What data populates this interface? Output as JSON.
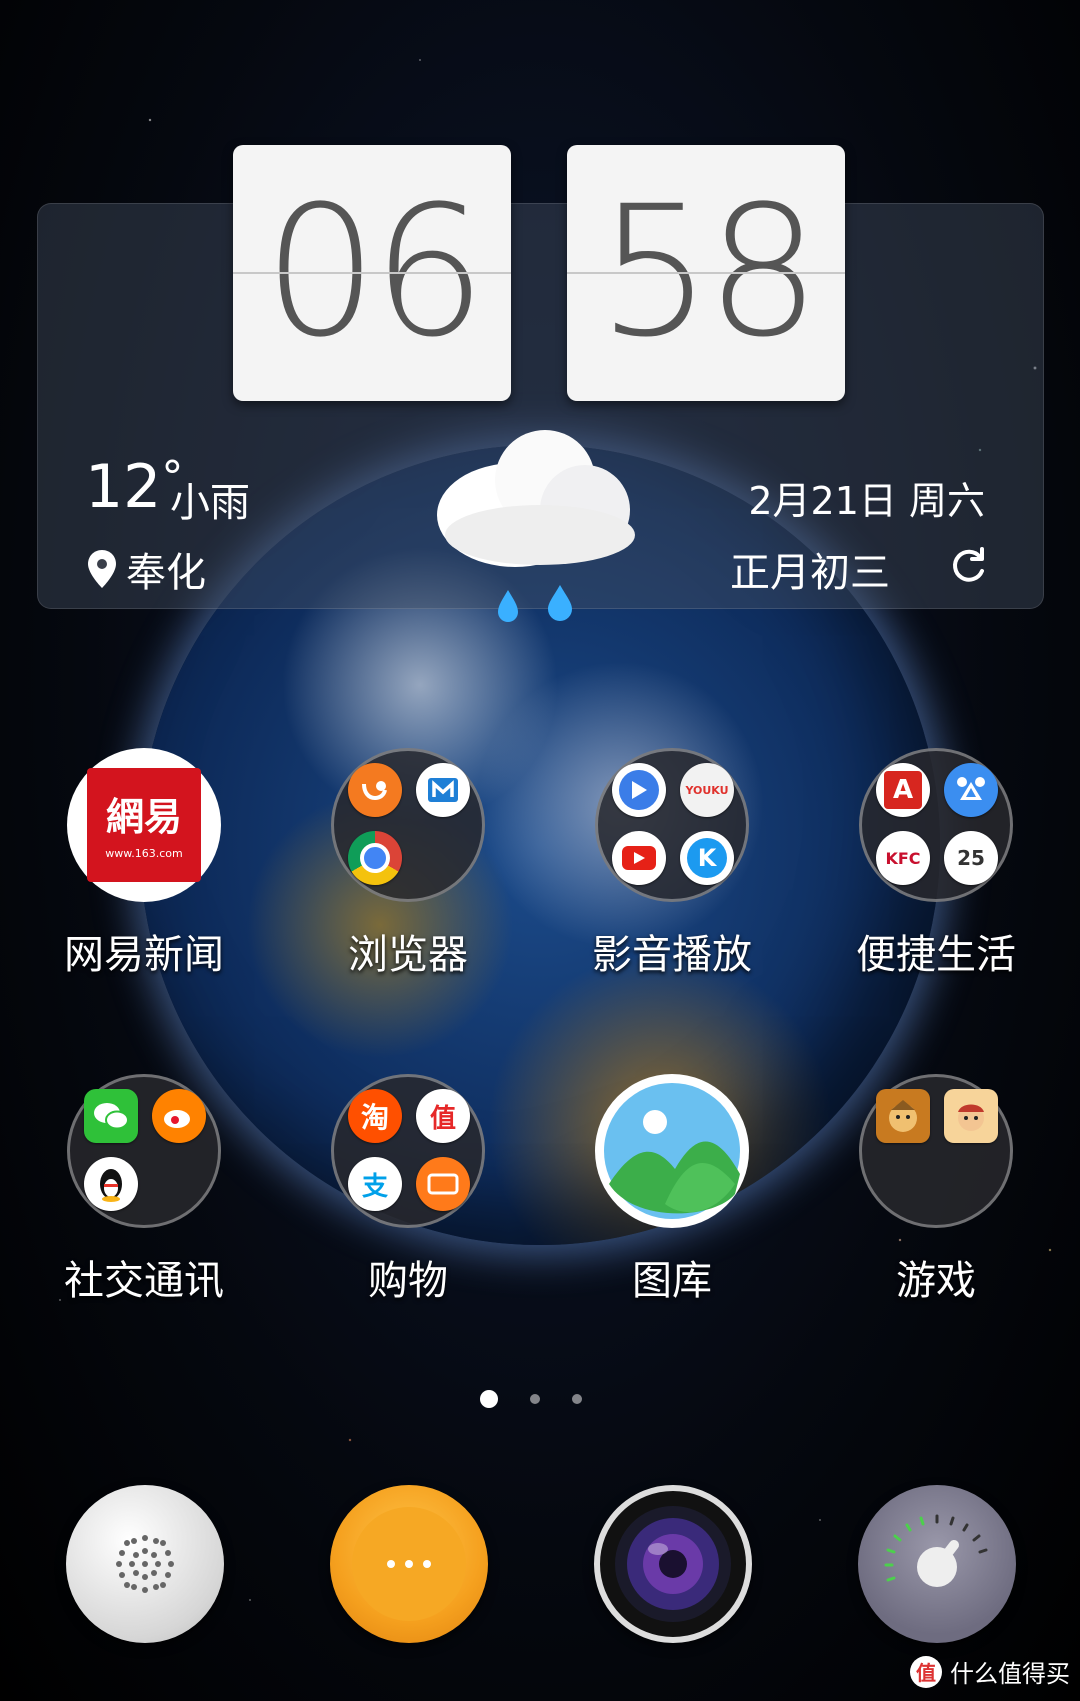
{
  "clock": {
    "hours": "06",
    "minutes": "58"
  },
  "weather": {
    "temp": "12",
    "degree_symbol": "°",
    "condition": "小雨",
    "city": "奉化"
  },
  "date": {
    "solar": "2月21日  周六",
    "lunar": "正月初三"
  },
  "apps_row1": [
    {
      "label": "网易新闻",
      "logo_text": "網易",
      "logo_sub": "www.163.com"
    },
    {
      "label": "浏览器"
    },
    {
      "label": "影音播放"
    },
    {
      "label": "便捷生活"
    }
  ],
  "apps_row2": [
    {
      "label": "社交通讯"
    },
    {
      "label": "购物"
    },
    {
      "label": "图库"
    },
    {
      "label": "游戏"
    }
  ],
  "mini_icons": {
    "browser": [
      "uc-browser-icon",
      "maxthon-icon",
      "chrome-icon"
    ],
    "media": [
      "video-player-icon",
      "youku-icon",
      "youtube-icon",
      "kugou-icon"
    ],
    "life": [
      "a-app-icon",
      "baidu-map-icon",
      "kfc-icon",
      "calendar-icon"
    ],
    "social": [
      "wechat-icon",
      "weibo-icon",
      "qq-icon"
    ],
    "shopping": [
      "taobao-icon",
      "smzdm-icon",
      "alipay-icon",
      "tuniu-icon"
    ],
    "games": [
      "clash-of-clans-icon",
      "game-icon"
    ]
  },
  "mini_texts": {
    "youku": "YOUKU",
    "kugou": "K",
    "kfc": "KFC",
    "calendar": "25",
    "taobao": "淘",
    "smzdm": "值",
    "alipay": "支",
    "a_app": "A"
  },
  "pages": {
    "count": 3,
    "current": 1
  },
  "dock": [
    "phone-dialer-icon",
    "app-drawer-icon",
    "camera-icon",
    "settings-dial-icon"
  ],
  "watermark": {
    "badge": "值",
    "text": "什么值得买"
  },
  "colors": {
    "netease_red": "#d3141e",
    "drawer_orange": "#f5a01e",
    "weather_drop": "#3ab0ff"
  }
}
